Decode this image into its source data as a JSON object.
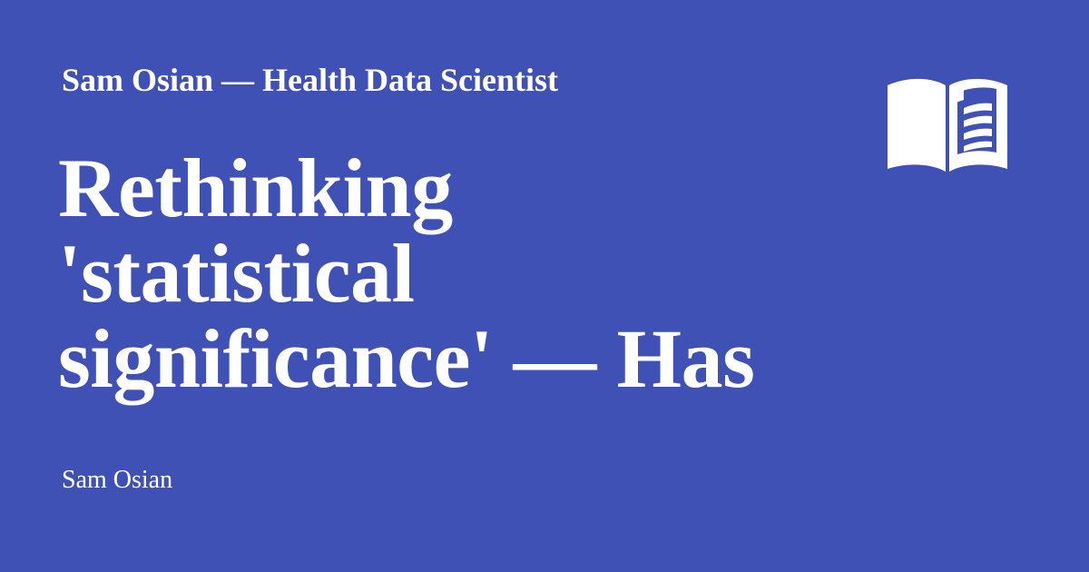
{
  "card": {
    "background_color": "#4051b5",
    "text_color": "#ffffff",
    "site_title": "Sam Osian — Health Data Scientist",
    "headline_lines": [
      "Rethinking",
      "'statistical",
      "significance' — Has"
    ],
    "author": "Sam Osian",
    "logo_icon": "open-book-icon"
  }
}
